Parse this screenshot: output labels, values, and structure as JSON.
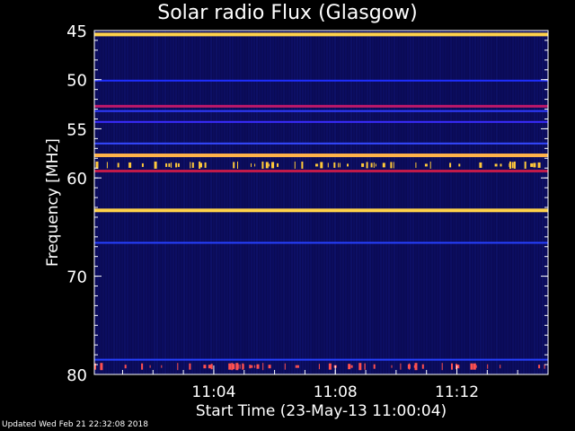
{
  "chart_data": {
    "type": "heatmap",
    "title": "Solar radio Flux (Glasgow)",
    "ylabel": "Frequency [MHz]",
    "xlabel": "Start Time (23-May-13 11:00:04)",
    "ylim": [
      45,
      80
    ],
    "y_inverted": true,
    "y_ticks": [
      45,
      50,
      55,
      60,
      70,
      80
    ],
    "x_ticks": [
      "11:04",
      "11:08",
      "11:12"
    ],
    "x_range_minutes": [
      0.07,
      15.0
    ],
    "x_tick_minutes": [
      4,
      8,
      12
    ],
    "emission_bands": [
      {
        "freq": 45.4,
        "intensity": "high",
        "color": "#ffd24a"
      },
      {
        "freq": 50.1,
        "intensity": "low",
        "color": "#1f2fff"
      },
      {
        "freq": 52.7,
        "intensity": "medium",
        "color": "#c0186a"
      },
      {
        "freq": 53.2,
        "intensity": "low",
        "color": "#2e3cff"
      },
      {
        "freq": 54.3,
        "intensity": "low",
        "color": "#3a2cff"
      },
      {
        "freq": 56.5,
        "intensity": "low",
        "color": "#3448ff"
      },
      {
        "freq": 57.7,
        "intensity": "high",
        "color": "#ffb34a"
      },
      {
        "freq": 58.7,
        "intensity": "bursty",
        "color": "#ffc83a"
      },
      {
        "freq": 59.3,
        "intensity": "medium",
        "color": "#c01a4a"
      },
      {
        "freq": 63.3,
        "intensity": "high",
        "color": "#ffd24a"
      },
      {
        "freq": 66.6,
        "intensity": "low",
        "color": "#2640ff"
      },
      {
        "freq": 78.5,
        "intensity": "low",
        "color": "#2640ff"
      },
      {
        "freq": 79.2,
        "intensity": "bursty",
        "color": "#ff5050"
      }
    ],
    "colors": {
      "background": "#000000",
      "low": "#0a0a55",
      "mid": "#c01a4a",
      "high": "#ffd24a"
    }
  },
  "footer": "Updated Wed Feb 21 22:32:08 2018"
}
